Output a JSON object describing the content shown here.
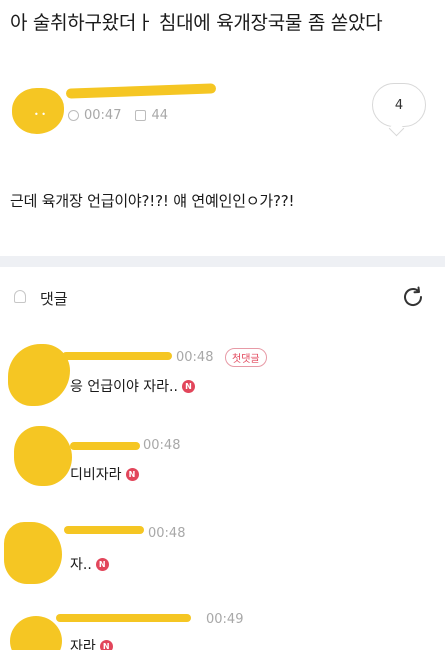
{
  "post": {
    "title": "아 술취하구왔더ㅏ 침대에 육개장국물 좀 쏟았다",
    "time": "00:47",
    "views": "44",
    "comment_count": "4",
    "body": "근데 육개장 언급이야?!?! 얘 연예인인ㅇ가??!"
  },
  "comments_section": {
    "label": "댓글"
  },
  "comments": [
    {
      "time": "00:48",
      "text": "응 언급이야 자라..",
      "badge": "첫댓글",
      "new": "N"
    },
    {
      "time": "00:48",
      "text": "디비자라",
      "new": "N"
    },
    {
      "time": "00:48",
      "text": "자..",
      "new": "N"
    },
    {
      "time": "00:49",
      "text": "자라",
      "new": "N"
    }
  ],
  "colors": {
    "scribble": "#f5c623",
    "accent": "#e2465b",
    "muted": "#a8a8a8"
  }
}
